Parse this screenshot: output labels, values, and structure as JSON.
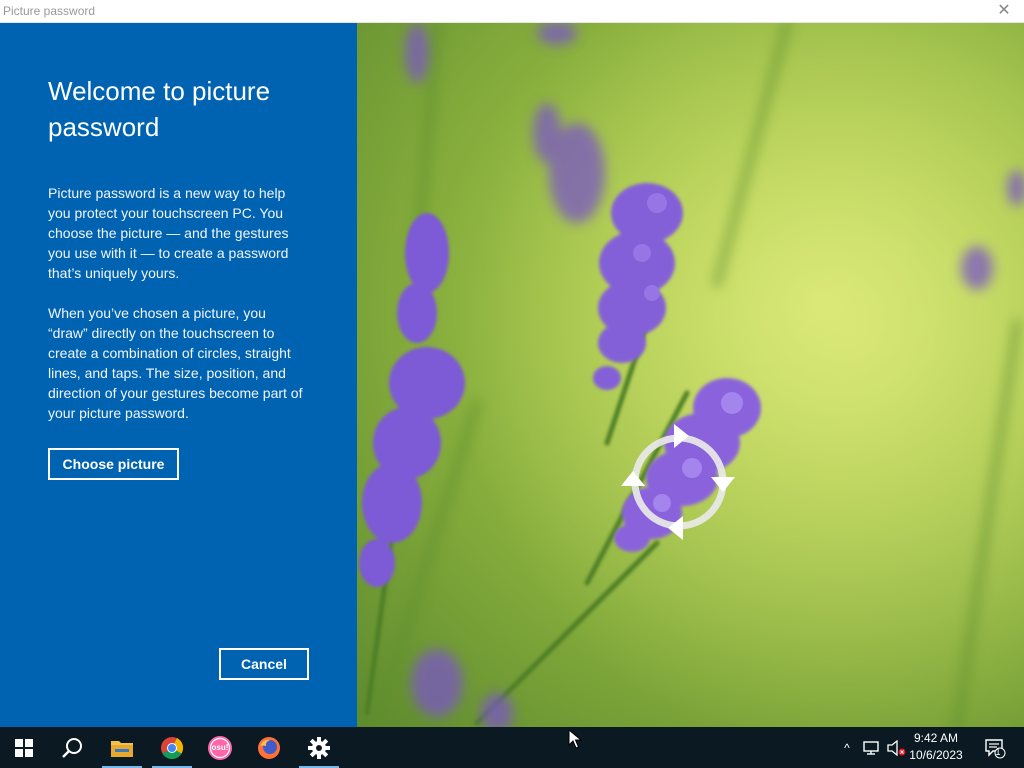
{
  "window": {
    "title": "Picture password",
    "close_glyph": "✕"
  },
  "panel": {
    "heading": "Welcome to picture password",
    "paragraph1": "Picture password is a new way to help you protect your touchscreen PC. You choose the picture — and the gestures you use with it — to create a password that’s uniquely yours.",
    "paragraph2": "When you’ve chosen a picture, you “draw” directly on the touchscreen to create a combination of circles, straight lines, and taps. The size, position, and direction of your gestures become part of your picture password.",
    "choose_label": "Choose picture",
    "cancel_label": "Cancel",
    "background_color": "#0063b1"
  },
  "picture": {
    "description_icon": "lavender-photo",
    "gesture_icon": "circle-gesture-icon"
  },
  "taskbar": {
    "apps": [
      {
        "name": "start",
        "icon": "windows-logo-icon"
      },
      {
        "name": "search",
        "icon": "search-icon"
      },
      {
        "name": "file-explorer",
        "icon": "folder-icon"
      },
      {
        "name": "chrome",
        "icon": "chrome-icon"
      },
      {
        "name": "osu",
        "icon": "osu-icon",
        "label": "osu!"
      },
      {
        "name": "firefox",
        "icon": "firefox-icon"
      },
      {
        "name": "settings",
        "icon": "gear-icon"
      }
    ],
    "clock": {
      "time": "9:42 AM",
      "date": "10/6/2023"
    },
    "notification_count": "1"
  }
}
